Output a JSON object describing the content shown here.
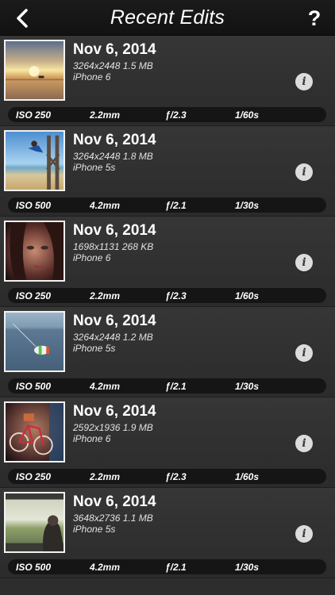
{
  "navbar": {
    "title": "Recent Edits",
    "back_icon": "chevron-left-icon",
    "help_label": "?"
  },
  "edits": [
    {
      "date": "Nov 6, 2014",
      "resolution": "3264x2448",
      "size": "1.5 MB",
      "device": "iPhone 6",
      "iso": "ISO 250",
      "focal": "2.2mm",
      "aperture": "ƒ/2.3",
      "shutter": "1/60s"
    },
    {
      "date": "Nov 6, 2014",
      "resolution": "3264x2448",
      "size": "1.8 MB",
      "device": "iPhone 5s",
      "iso": "ISO 500",
      "focal": "4.2mm",
      "aperture": "ƒ/2.1",
      "shutter": "1/30s"
    },
    {
      "date": "Nov 6, 2014",
      "resolution": "1698x1131",
      "size": "268 KB",
      "device": "iPhone 6",
      "iso": "ISO 250",
      "focal": "2.2mm",
      "aperture": "ƒ/2.3",
      "shutter": "1/60s"
    },
    {
      "date": "Nov 6, 2014",
      "resolution": "3264x2448",
      "size": "1.2 MB",
      "device": "iPhone 5s",
      "iso": "ISO 500",
      "focal": "4.2mm",
      "aperture": "ƒ/2.1",
      "shutter": "1/30s"
    },
    {
      "date": "Nov 6, 2014",
      "resolution": "2592x1936",
      "size": "1.9 MB",
      "device": "iPhone 6",
      "iso": "ISO 250",
      "focal": "2.2mm",
      "aperture": "ƒ/2.3",
      "shutter": "1/60s"
    },
    {
      "date": "Nov 6, 2014",
      "resolution": "3648x2736",
      "size": "1.1 MB",
      "device": "iPhone 5s",
      "iso": "ISO 500",
      "focal": "4.2mm",
      "aperture": "ƒ/2.1",
      "shutter": "1/30s"
    }
  ],
  "info_label": "i",
  "colors": {
    "background": "#2d2d2d",
    "navbar": "#141414",
    "exif_bar": "#151515",
    "info_button": "#dcdcdc"
  }
}
